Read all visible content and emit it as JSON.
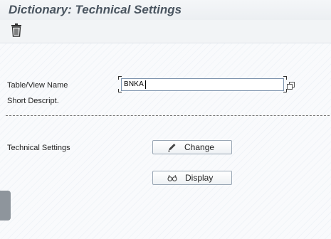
{
  "header": {
    "title": "Dictionary: Technical Settings"
  },
  "toolbar": {
    "delete_icon": "trash-icon"
  },
  "form": {
    "table_view_label": "Table/View Name",
    "table_view_value": "BNKA",
    "short_desc_label": "Short Descript.",
    "value_help_icon": "value-help-icon"
  },
  "technical": {
    "label": "Technical Settings",
    "change_label": "Change",
    "change_icon": "pencil-icon",
    "display_label": "Display",
    "display_icon": "glasses-icon"
  },
  "colors": {
    "title": "#4a5560",
    "field_border": "#7d93ad",
    "button_border": "#9aa7b5"
  }
}
